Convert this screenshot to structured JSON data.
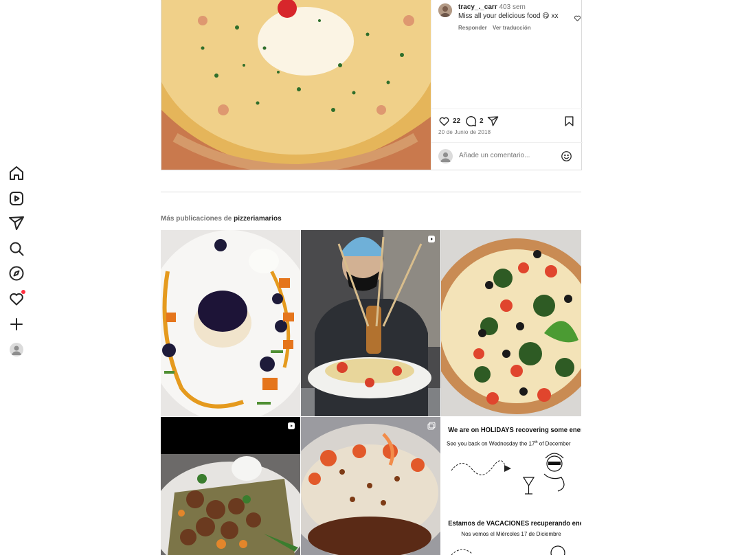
{
  "comment": {
    "username": "tracy_._carr",
    "time": "403 sem",
    "text": "Miss all your delicious food 😋 xx",
    "reply": "Responder",
    "translate": "Ver traducción"
  },
  "post": {
    "likes": "22",
    "comments": "2",
    "date": "20 de Junio de 2018",
    "add_comment_placeholder": "Añade un comentario..."
  },
  "more": {
    "prefix": "Más publicaciones de",
    "account": "pizzeriamarios"
  },
  "nav": {
    "items": [
      "home-icon",
      "reels-icon",
      "messages-icon",
      "search-icon",
      "explore-icon",
      "notifications-icon",
      "create-icon",
      "profile-avatar"
    ],
    "notification_dot_color": "#ff3040"
  },
  "holiday_card": {
    "line1": "We are on HOLIDAYS recovering some energy!",
    "line2_pre": "See you back on Wednesday the 17",
    "line2_sup": "th",
    "line2_post": " of  December",
    "line3": "Estamos de VACACIONES recuperando energías!",
    "line4": "Nos vemos el Miércoles 17 de Diciembre"
  },
  "colors": {
    "text": "#262626",
    "secondary": "#737373",
    "border": "#dbdbdb"
  }
}
